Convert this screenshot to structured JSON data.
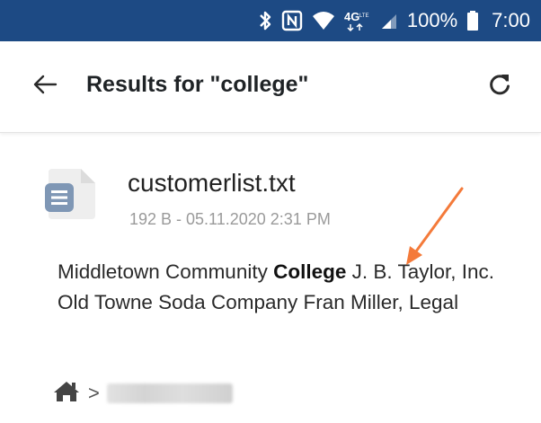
{
  "status_bar": {
    "icons": [
      "bluetooth-icon",
      "nfc-icon",
      "wifi-icon",
      "4g-lte-icon",
      "signal-icon",
      "battery-icon"
    ],
    "battery": "100%",
    "time": "7:00",
    "background": "#1d4a84"
  },
  "app_bar": {
    "back_icon": "arrow-left-icon",
    "title": "Results for \"college\"",
    "refresh_icon": "refresh-icon"
  },
  "result": {
    "file_icon": "text-document-icon",
    "file_name": "customerlist.txt",
    "file_meta": "192 B - 05.11.2020 2:31 PM",
    "snippet_before": "Middletown Community ",
    "snippet_highlight": "College",
    "snippet_after": " J. B. Taylor, Inc. Old Towne Soda Company Fran Miller, Legal"
  },
  "breadcrumb": {
    "home_icon": "home-icon",
    "separator": ">"
  },
  "colors": {
    "accent": "#1d4a84",
    "arrow": "#f47a3a",
    "file_icon": "#7f97b5"
  }
}
